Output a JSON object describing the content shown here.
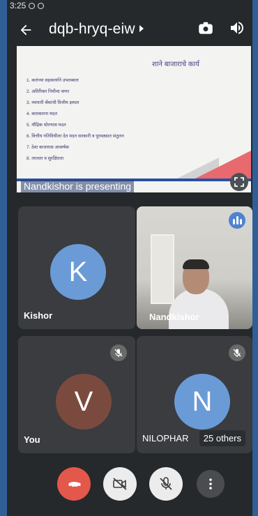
{
  "status": {
    "time": "3:25"
  },
  "header": {
    "title": "dqb-hryq-eiw"
  },
  "presentation": {
    "slide_title": "शाने बाजाराचे कार्य",
    "slide_items": [
      "1. करांच्या सहकार्याने उपलब्धता",
      "2. अतिरिक्त निधीचा वापर",
      "3. व्यापारी बँकांची वित्तीय क्षमता",
      "4. कराकारना मदत",
      "5. मौद्रिक धोरणास मदत",
      "6. वित्तीय गतिविधीला देत मदत सरकारी व पुरवठ्यात संतुलन",
      "7. ठेवा बाजारास आकर्षक",
      "8. तरलता व सुरक्षितता"
    ],
    "presenting_label": "Nandkishor is presenting"
  },
  "participants": [
    {
      "name": "Kishor",
      "initial": "K",
      "color": "#6a9bd6"
    },
    {
      "name": "Nandkishor",
      "initial": "",
      "color": "#5b5a56"
    },
    {
      "name": "You",
      "initial": "V",
      "color": "#7b4a3f"
    },
    {
      "name": "NILOPHAR",
      "initial": "N",
      "color": "#6a9bd6"
    }
  ],
  "others_label": "25 others",
  "controls": {
    "end_call_color": "#e4574b",
    "icons": [
      "end-call-icon",
      "camera-off-icon",
      "mic-off-icon",
      "more-vert-icon"
    ]
  }
}
